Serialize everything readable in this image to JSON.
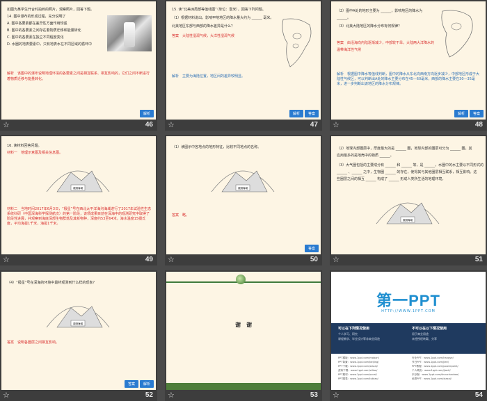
{
  "pages": [
    {
      "number": "46",
      "lines": [
        "如图为某学生开合时拍到的照片，观察照片，回答下题。",
        "14. 图中瀑布的形成过程，充分说明了",
        "A. 图中各要素都在差异性方面作用较强",
        "B. 图中的各要素之间存在着物质迁移和能量转化",
        "C. 图中的各要素在独立不同程度变化",
        "D. 水圈的地表要素中，只有地表水在不同区域的循环中"
      ],
      "analysis": "解析　该图中的瀑布说明地理环境的各要素之间是相互联系、相互影响的，它们之间不断进行着物质迁移与能量转化。",
      "buttons": [
        "解析"
      ]
    },
    {
      "number": "47",
      "lines": [
        "15. 读“北美洲局部等值线图”（单位：毫米），回答下列问题。",
        "（1）根据材料说出，影响甲地地区的降水量大约为 ______ 毫米。",
        "北美地区东部与西部的降水差异是什么？"
      ],
      "answer": "答案　大陆性湿润气候，大洋性湿润气候",
      "analysis": "解析　主要为海陆位置，地区间的差异较明显。",
      "buttons": [
        "解析",
        "答案"
      ]
    },
    {
      "number": "48",
      "lines": [
        "（2）图中A处的地形主要为 ______，影响地区的降水为",
        "______。",
        "（3）北美大陆地区的降水分布有何规律？"
      ],
      "answer": "答案　由沿海向内陆逐渐减少，中部较干旱，大陆两大洋降水的",
      "answer2": "温带海洋性气候",
      "analysis": "解析　根据图中降水等值线判断，图中的降水从东北向西南方向逐步减少，中部地区形成于大陆性气候区，可以判断出A处的降水主要分布在45—60毫米，西部的降水主要在30—35毫米，进一步判断出该地区的降水分布规律。",
      "buttons": [
        "解析",
        "答案"
      ]
    },
    {
      "number": "49",
      "lines": [
        "16. 读材料回答问题。",
        "材料一　地理示意图及相关信息图。"
      ],
      "material2": "材料二　当地时间2017年6月3日，“极星”号在西北太平洋海沟海域进行了2017年试验性生态系统科研（中国深海科学探测航次）的第一阶段，该项成果目前在深海中的观测研究中取得了阶段性进展，并观察到海底深部生物群落及其新物种，深度约53至64米，海水温度15摄氏度，平均海拔1千米，海拔1千米。",
      "label": "观测海域",
      "buttons": []
    },
    {
      "number": "50",
      "lines": [
        "（1）读图示中各地点的地形特征，比较不同地点的名称。"
      ],
      "answer": "答案　略。",
      "label": "观测海域",
      "buttons": [
        "答案"
      ]
    },
    {
      "number": "51",
      "lines": [
        "（2）地球内部圈层中，厚度最大的是 ______ 圈，地球内部的圈层可分为 ______ 圈，其",
        "应用最多的是地壳中的物质 ______。",
        "（3）大气圈包括的主要成分有 ______ 和 ______ 等，是 ______，水圈中的水主要以不同形式的",
        "______ 、______ 之中，生物圈 ______ 的存在，使得其与其他圈层相互联系，相互影响。这",
        "些圈层之间的相互 ______ 构成了 ______ 形成人类所生活的地理环境。"
      ],
      "label": "观测海域",
      "buttons": []
    },
    {
      "number": "52",
      "lines": [
        "（4）“极星”号在深海的环境中最终观测到什么样的现象？"
      ],
      "answer": "答案　说明各圈层之间相互影响。",
      "label": "观测海域",
      "buttons": [
        "答案",
        "解析"
      ]
    },
    {
      "number": "53",
      "title": "谢　谢",
      "buttons": []
    },
    {
      "number": "54",
      "brand": "第一PPT",
      "url": "HTTP://WWW.1PPT.COM",
      "band": {
        "left_title": "可以在下列情况使用",
        "left_items": [
          "个人学习、研究",
          "课程教学、毕业设计等非商业用途"
        ],
        "right_title": "不可以在以下情况使用",
        "right_items": [
          "用于商业用途",
          "未经授权转载、分享"
        ]
      },
      "links": [
        "PPT模板：www.1ppt.com/moban/",
        "PPT背景：www.1ppt.com/beijing/",
        "PPT下载：www.1ppt.com/xiazai/",
        "资料下载：www.1ppt.com/ziliao/",
        "PPT素材：www.1ppt.com/sucai/",
        "PPT图表：www.1ppt.com/tubiao/",
        "行业PPT：www.1ppt.com/hangye/",
        "节日PPT：www.1ppt.com/jieri/",
        "PPT教程：www.1ppt.com/powerpoint/",
        "个人简历：www.1ppt.com/jianli/",
        "手抄报：www.1ppt.com/shouchaobao/",
        "优秀PPT：www.1ppt.com/xiazai/"
      ]
    }
  ]
}
